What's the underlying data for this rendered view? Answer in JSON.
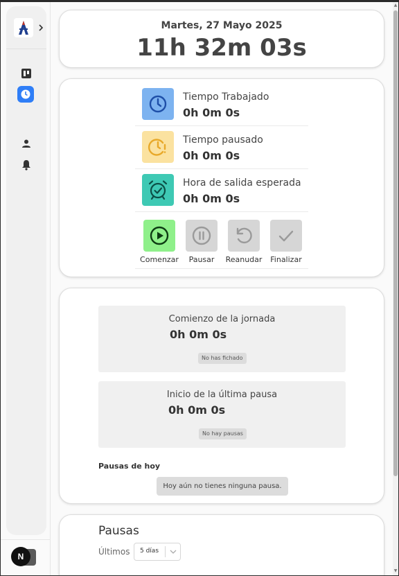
{
  "clock": {
    "date": "Martes, 27 Mayo 2025",
    "time": "11h 32m 03s"
  },
  "stats": [
    {
      "label": "Tiempo Trabajado",
      "value": "0h 0m 0s",
      "icon": "clock-icon",
      "color": "#7db3f0"
    },
    {
      "label": "Tiempo pausado",
      "value": "0h 0m 0s",
      "icon": "clock-alert-icon",
      "color": "#fbe2a0"
    },
    {
      "label": "Hora de salida esperada",
      "value": "0h 0m 0s",
      "icon": "alarm-check-icon",
      "color": "#3ec9b4"
    }
  ],
  "actions": [
    {
      "label": "Comenzar",
      "icon": "play-icon",
      "color": "#8ff08a"
    },
    {
      "label": "Pausar",
      "icon": "pause-icon",
      "color": "#d6d6d6"
    },
    {
      "label": "Reanudar",
      "icon": "rotate-ccw-icon",
      "color": "#d6d6d6"
    },
    {
      "label": "Finalizar",
      "icon": "check-icon",
      "color": "#d6d6d6"
    }
  ],
  "day": {
    "start": {
      "title": "Comienzo de la jornada",
      "value": "0h 0m 0s",
      "badge": "No has fichado"
    },
    "last_pause": {
      "title": "Inicio de la última pausa",
      "value": "0h 0m 0s",
      "badge": "No hay pausas"
    },
    "pauses_today_label": "Pausas de hoy",
    "pauses_today_empty": "Hoy aún no tienes ninguna pausa."
  },
  "pauses": {
    "title": "Pausas",
    "filter_label": "Últimos",
    "filter_value": "5 días"
  },
  "sidebar": {
    "items": [
      {
        "name": "board",
        "icon": "kanban-board-icon"
      },
      {
        "name": "clock",
        "icon": "clock-icon",
        "active": true
      },
      {
        "name": "profile",
        "icon": "user-icon"
      },
      {
        "name": "notifications",
        "icon": "bell-icon"
      }
    ],
    "avatar_letter": "N",
    "accent": "#2f7ef7"
  }
}
